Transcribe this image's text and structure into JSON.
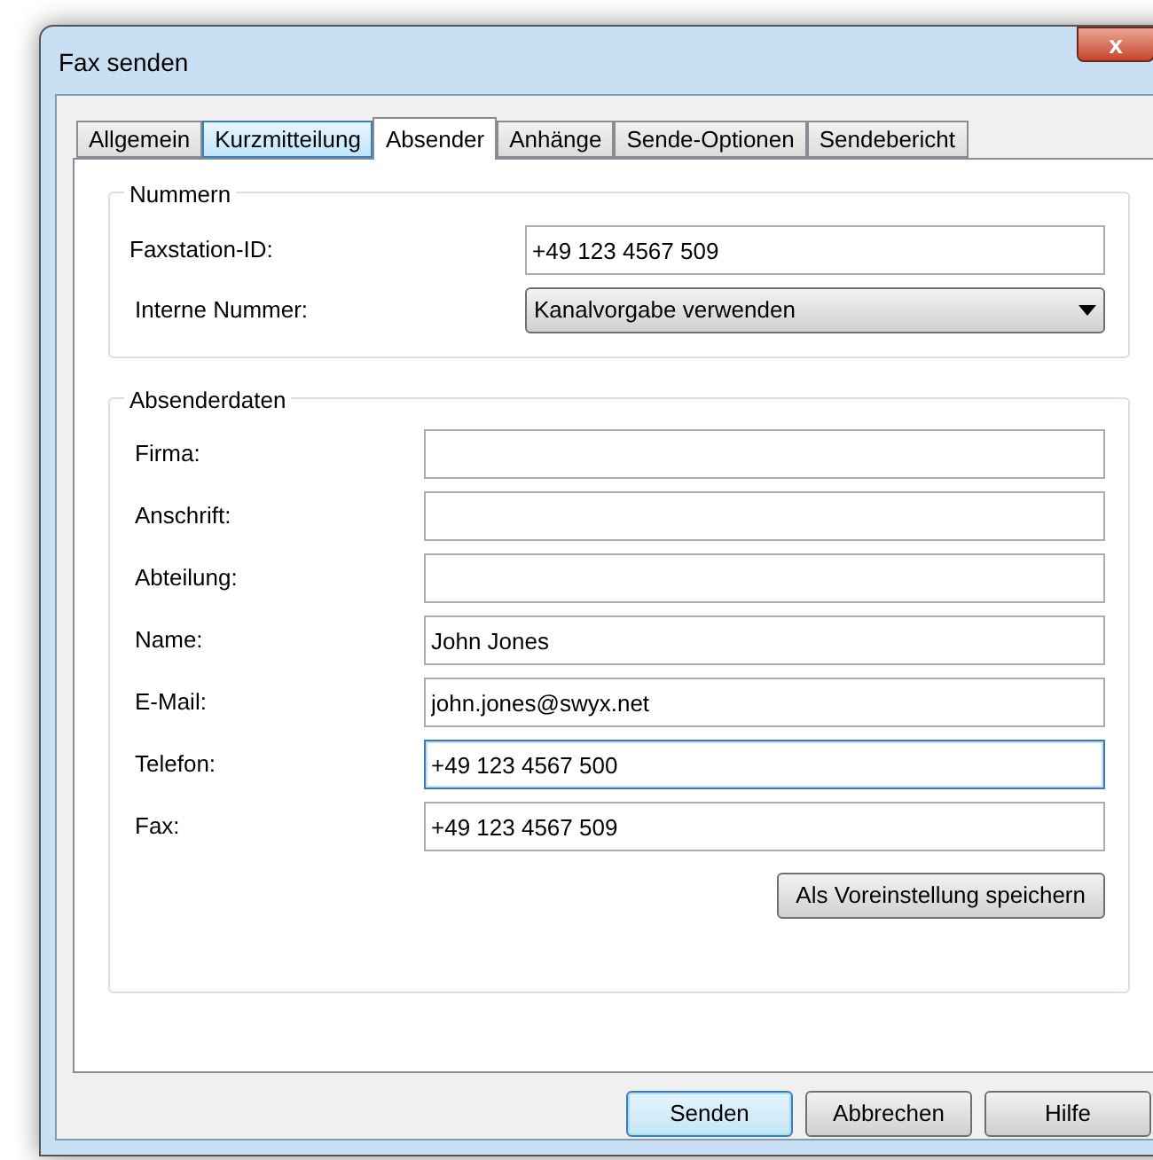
{
  "window": {
    "title": "Fax senden",
    "close": "x"
  },
  "tabs": [
    {
      "label": "Allgemein",
      "selected": false,
      "hovered": false
    },
    {
      "label": "Kurzmitteilung",
      "selected": false,
      "hovered": true
    },
    {
      "label": "Absender",
      "selected": true,
      "hovered": false
    },
    {
      "label": "Anhänge",
      "selected": false,
      "hovered": false
    },
    {
      "label": "Sende-Optionen",
      "selected": false,
      "hovered": false
    },
    {
      "label": "Sendebericht",
      "selected": false,
      "hovered": false
    }
  ],
  "nummern": {
    "title": "Nummern",
    "faxstation_id": {
      "label": "Faxstation-ID:",
      "value": "+49 123 4567 509"
    },
    "interne_nummer": {
      "label": "Interne Nummer:",
      "value": "Kanalvorgabe verwenden"
    }
  },
  "absenderdaten": {
    "title": "Absenderdaten",
    "fields": [
      {
        "label": "Firma:",
        "focused": false
      },
      {
        "label": "Anschrift:",
        "focused": false
      },
      {
        "label": "Abteilung:",
        "focused": false
      },
      {
        "label": "Name:",
        "value": "John Jones",
        "focused": false
      },
      {
        "label": "E-Mail:",
        "value": "john.jones@swyx.net",
        "focused": false
      },
      {
        "label": "Telefon:",
        "value": "+49 123 4567 500",
        "focused": true
      },
      {
        "label": "Fax:",
        "value": "+49 123 4567 509",
        "focused": false
      }
    ],
    "save_button": "Als Voreinstellung speichern"
  },
  "buttons": [
    {
      "label": "Senden",
      "default": true
    },
    {
      "label": "Abbrechen",
      "default": false
    },
    {
      "label": "Hilfe",
      "default": false
    }
  ]
}
